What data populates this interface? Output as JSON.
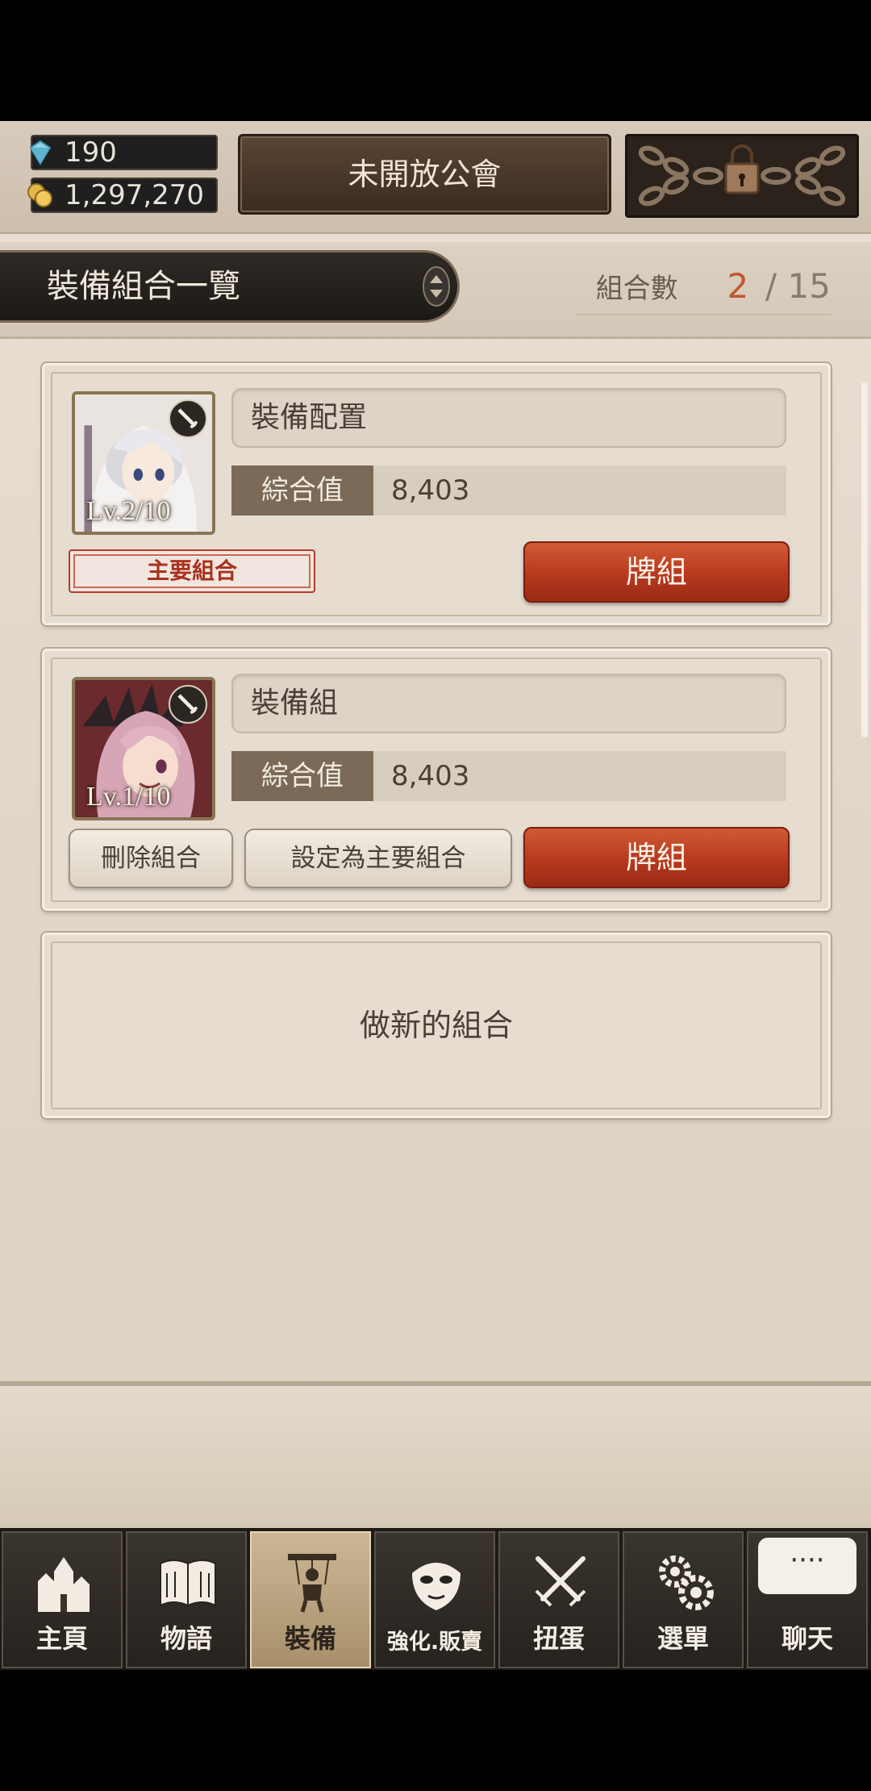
{
  "currency": {
    "gems": "190",
    "gold": "1,297,270"
  },
  "guild": {
    "label": "未開放公會"
  },
  "header": {
    "title": "裝備組合一覽",
    "count_label": "組合數",
    "count_current": "2",
    "count_max": "/ 15"
  },
  "sets": [
    {
      "name": "裝備配置",
      "stat_label": "綜合值",
      "stat_value": "8,403",
      "level": "Lv.2/10",
      "main_tag": "主要組合",
      "deck_label": "牌組"
    },
    {
      "name": "裝備組",
      "stat_label": "綜合值",
      "stat_value": "8,403",
      "level": "Lv.1/10",
      "delete_label": "刪除組合",
      "set_main_label": "設定為主要組合",
      "deck_label": "牌組"
    }
  ],
  "new_set": {
    "label": "做新的組合"
  },
  "nav": [
    {
      "label": "主頁",
      "icon": "castle-icon"
    },
    {
      "label": "物語",
      "icon": "book-icon"
    },
    {
      "label": "裝備",
      "icon": "puppet-icon",
      "active": true
    },
    {
      "label": "強化.販賣",
      "icon": "mask-icon"
    },
    {
      "label": "扭蛋",
      "icon": "swords-icon"
    },
    {
      "label": "選單",
      "icon": "gears-icon"
    },
    {
      "label": "聊天",
      "icon": "chat-icon",
      "bubble": "····"
    }
  ],
  "colors": {
    "accent_red": "#b7391e",
    "count_highlight": "#c0582e",
    "dark_panel": "#1f1f1f"
  }
}
